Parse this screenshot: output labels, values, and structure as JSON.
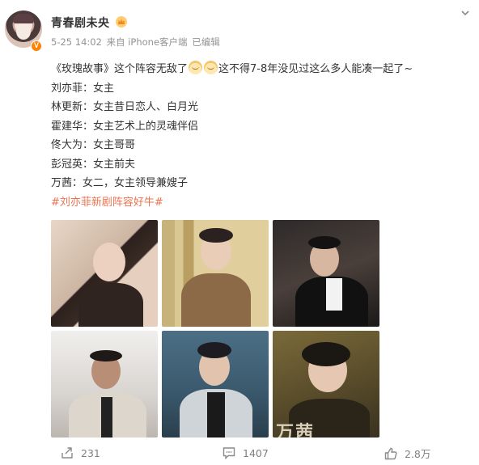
{
  "post": {
    "username": "青春剧未央",
    "date": "5-25 14:02",
    "source": "来自 iPhone客户端",
    "edited": "已编辑",
    "lines": {
      "intro_a": "《玫瑰故事》这个阵容无敌了",
      "intro_b": "这不得7-8年没见过这么多人能凑一起了~",
      "l1": "刘亦菲：女主",
      "l2": "林更新：女主昔日恋人、白月光",
      "l3": "霍建华：女主艺术上的灵魂伴侣",
      "l4": "佟大为：女主哥哥",
      "l5": "彭冠英：女主前夫",
      "l6": "万茜：女二，女主领导兼嫂子"
    },
    "hashtag": "#刘亦菲新剧阵容好牛#",
    "photo_watermark": "万茜"
  },
  "actions": {
    "repost_count": "231",
    "comment_count": "1407",
    "like_count": "2.8万"
  },
  "colors": {
    "hashtag": "#eb7350",
    "meta": "#939393",
    "verified_badge": "#ff8200"
  },
  "icons": [
    "avatar",
    "verified-badge-icon",
    "crown-icon",
    "more-icon",
    "laugh-emoji-icon",
    "repost-icon",
    "comment-icon",
    "like-icon"
  ]
}
